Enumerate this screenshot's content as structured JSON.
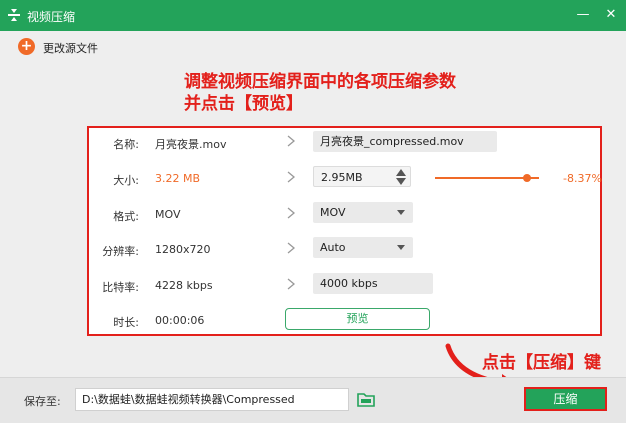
{
  "window": {
    "title": "视频压缩",
    "minimize_glyph": "—",
    "close_glyph": "✕"
  },
  "toolbar": {
    "change_source_label": "更改源文件"
  },
  "annotations": {
    "line1": "调整视频压缩界面中的各项压缩参数",
    "line2": "并点击【预览】",
    "compress_hint": "点击【压缩】键"
  },
  "settings": {
    "name": {
      "label": "名称:",
      "source": "月亮夜景.mov",
      "target": "月亮夜景_compressed.mov"
    },
    "size": {
      "label": "大小:",
      "source": "3.22 MB",
      "target": "2.95MB",
      "percent": "-8.37%",
      "slider_level": 0.88
    },
    "format": {
      "label": "格式:",
      "source": "MOV",
      "target": "MOV"
    },
    "resolution": {
      "label": "分辨率:",
      "source": "1280x720",
      "target": "Auto"
    },
    "bitrate": {
      "label": "比特率:",
      "source": "4228 kbps",
      "target": "4000 kbps"
    },
    "duration": {
      "label": "时长:",
      "source": "00:00:06",
      "preview_label": "预览"
    }
  },
  "footer": {
    "save_label": "保存至:",
    "save_path": "D:\\数据蛙\\数据蛙视频转换器\\Compressed",
    "compress_label": "压缩"
  },
  "colors": {
    "brand_green": "#23a35a",
    "accent_orange": "#f06a28",
    "annotation_red": "#e3201b"
  }
}
